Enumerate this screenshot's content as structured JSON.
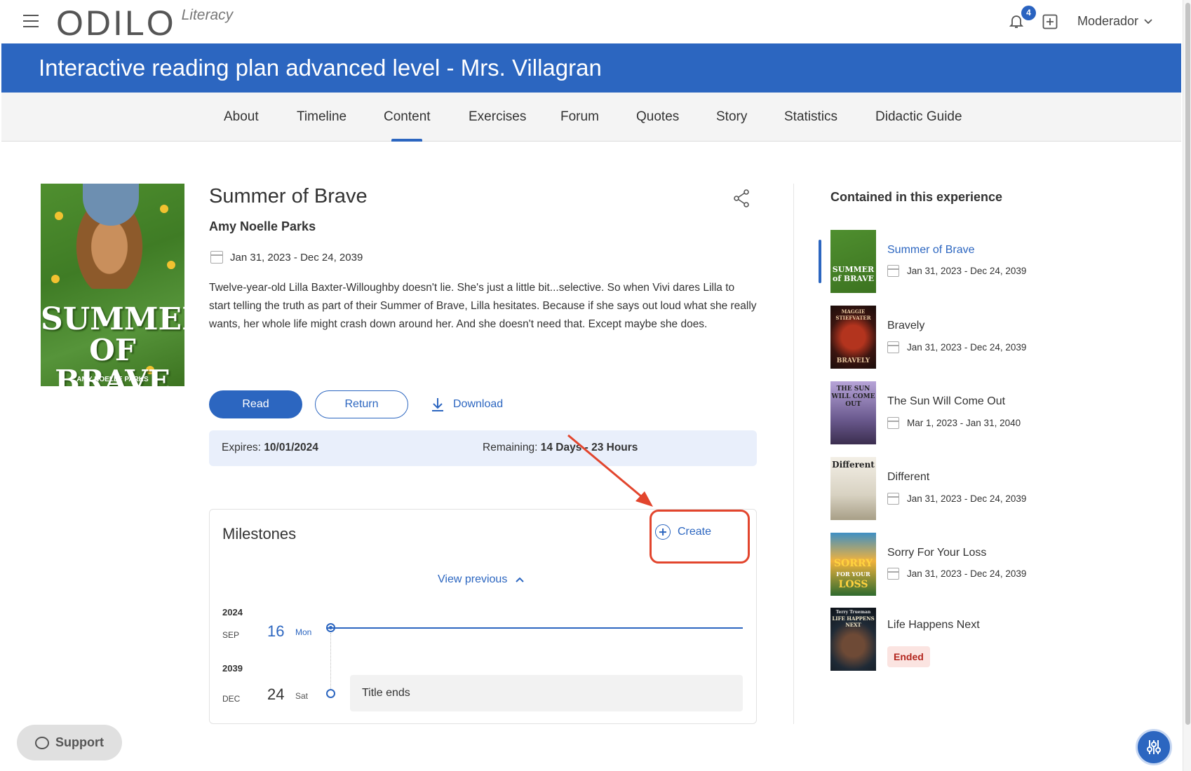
{
  "header": {
    "logo_text": "ODILO",
    "logo_sub": "Literacy",
    "notification_count": "4",
    "user_label": "Moderador"
  },
  "banner": {
    "title": "Interactive reading plan advanced level - Mrs. Villagran"
  },
  "tabs": [
    {
      "label": "About"
    },
    {
      "label": "Timeline"
    },
    {
      "label": "Content"
    },
    {
      "label": "Exercises"
    },
    {
      "label": "Forum"
    },
    {
      "label": "Quotes"
    },
    {
      "label": "Story"
    },
    {
      "label": "Statistics"
    },
    {
      "label": "Didactic Guide"
    }
  ],
  "active_tab": "Content",
  "book": {
    "title": "Summer of Brave",
    "author": "Amy Noelle Parks",
    "dates": "Jan 31, 2023 - Dec 24, 2039",
    "description": "Twelve-year-old Lilla Baxter-Willoughby doesn't lie. She's just a little bit...selective. So when Vivi dares Lilla to start telling the truth as part of their Summer of Brave, Lilla hesitates. Because if she says out loud what she really wants, her whole life might crash down around her. And she doesn't need that. Except maybe she does.",
    "cover_title_1": "SUMMER",
    "cover_title_2": "OF BRAVE",
    "cover_author": "AMY NOELLE PARKS"
  },
  "actions": {
    "read": "Read",
    "return": "Return",
    "download": "Download"
  },
  "loan": {
    "expires_label": "Expires:",
    "expires_value": "10/01/2024",
    "remaining_label": "Remaining:",
    "remaining_value": "14 Days - 23 Hours"
  },
  "milestones": {
    "title": "Milestones",
    "create": "Create",
    "view_previous": "View previous",
    "entries": [
      {
        "year": "2024",
        "month": "SEP",
        "day": "16",
        "weekday": "Mon"
      },
      {
        "year": "2039",
        "month": "DEC",
        "day": "24",
        "weekday": "Sat",
        "event": "Title ends"
      }
    ]
  },
  "contained": {
    "title": "Contained in this experience",
    "items": [
      {
        "name": "Summer of Brave",
        "dates": "Jan 31, 2023 - Dec 24, 2039",
        "active": true
      },
      {
        "name": "Bravely",
        "dates": "Jan 31, 2023 - Dec 24, 2039"
      },
      {
        "name": "The Sun Will Come Out",
        "dates": "Mar 1, 2023 - Jan 31, 2040"
      },
      {
        "name": "Different",
        "dates": "Jan 31, 2023 - Dec 24, 2039"
      },
      {
        "name": "Sorry For Your Loss",
        "dates": "Jan 31, 2023 - Dec 24, 2039"
      },
      {
        "name": "Life Happens Next",
        "status": "Ended"
      }
    ],
    "thumb_texts": {
      "summer": "SUMMER of BRAVE",
      "bravely_author": "MAGGIE STIEFVATER",
      "bravely": "BRAVELY",
      "sun": "THE SUN WILL COME OUT",
      "different": "Different",
      "sorry_1": "SORRY",
      "sorry_2": "FOR YOUR",
      "sorry_3": "LOSS",
      "life_author": "Terry Trueman",
      "life": "LIFE HAPPENS NEXT"
    }
  },
  "support": {
    "label": "Support"
  },
  "colors": {
    "primary": "#2c66c0",
    "ended_bg": "#fbe4e1",
    "ended_text": "#b3261e",
    "annotation": "#e2452d"
  }
}
